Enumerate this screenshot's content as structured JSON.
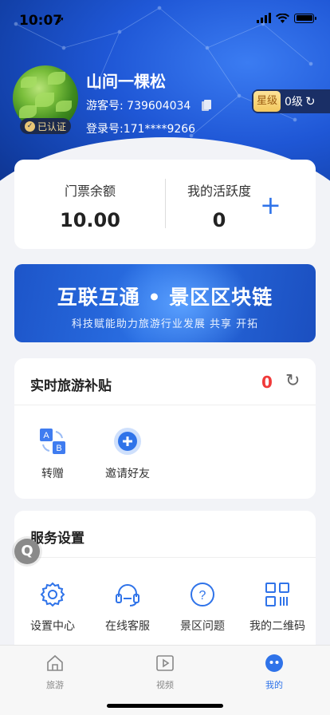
{
  "status_bar": {
    "time": "10:07",
    "location_arrow": "➚"
  },
  "profile": {
    "name": "山间一棵松",
    "visitor_id": "游客号: 739604034",
    "login_id": "登录号:171****9266",
    "verified": "已认证",
    "level_badge": "星级",
    "level_value": "0级"
  },
  "stats": {
    "ticket_label": "门票余额",
    "ticket_value": "10.00",
    "activity_label": "我的活跃度",
    "activity_value": "0",
    "add_symbol": "+"
  },
  "banner": {
    "title": "互联互通 • 景区区块链",
    "subtitle": "科技赋能助力旅游行业发展  共享  开拓"
  },
  "subsidy": {
    "title": "实时旅游补贴",
    "count": "0",
    "items": [
      {
        "label": "转赠",
        "icon": "transfer-ab-icon"
      },
      {
        "label": "邀请好友",
        "icon": "invite-plus-icon"
      }
    ]
  },
  "service": {
    "title": "服务设置",
    "items": [
      {
        "label": "设置中心",
        "icon": "gear-icon"
      },
      {
        "label": "在线客服",
        "icon": "headset-icon"
      },
      {
        "label": "景区问题",
        "icon": "question-icon"
      },
      {
        "label": "我的二维码",
        "icon": "qrcode-icon"
      }
    ]
  },
  "float_button": {
    "label": "Q"
  },
  "tabbar": {
    "items": [
      {
        "label": "旅游",
        "icon": "home-icon",
        "active": false
      },
      {
        "label": "视频",
        "icon": "video-icon",
        "active": false
      },
      {
        "label": "我的",
        "icon": "profile-icon",
        "active": true
      }
    ]
  },
  "colors": {
    "accent": "#2f73e9",
    "subsidy_count": "#f03a3a",
    "hero": "#1f57d6"
  }
}
